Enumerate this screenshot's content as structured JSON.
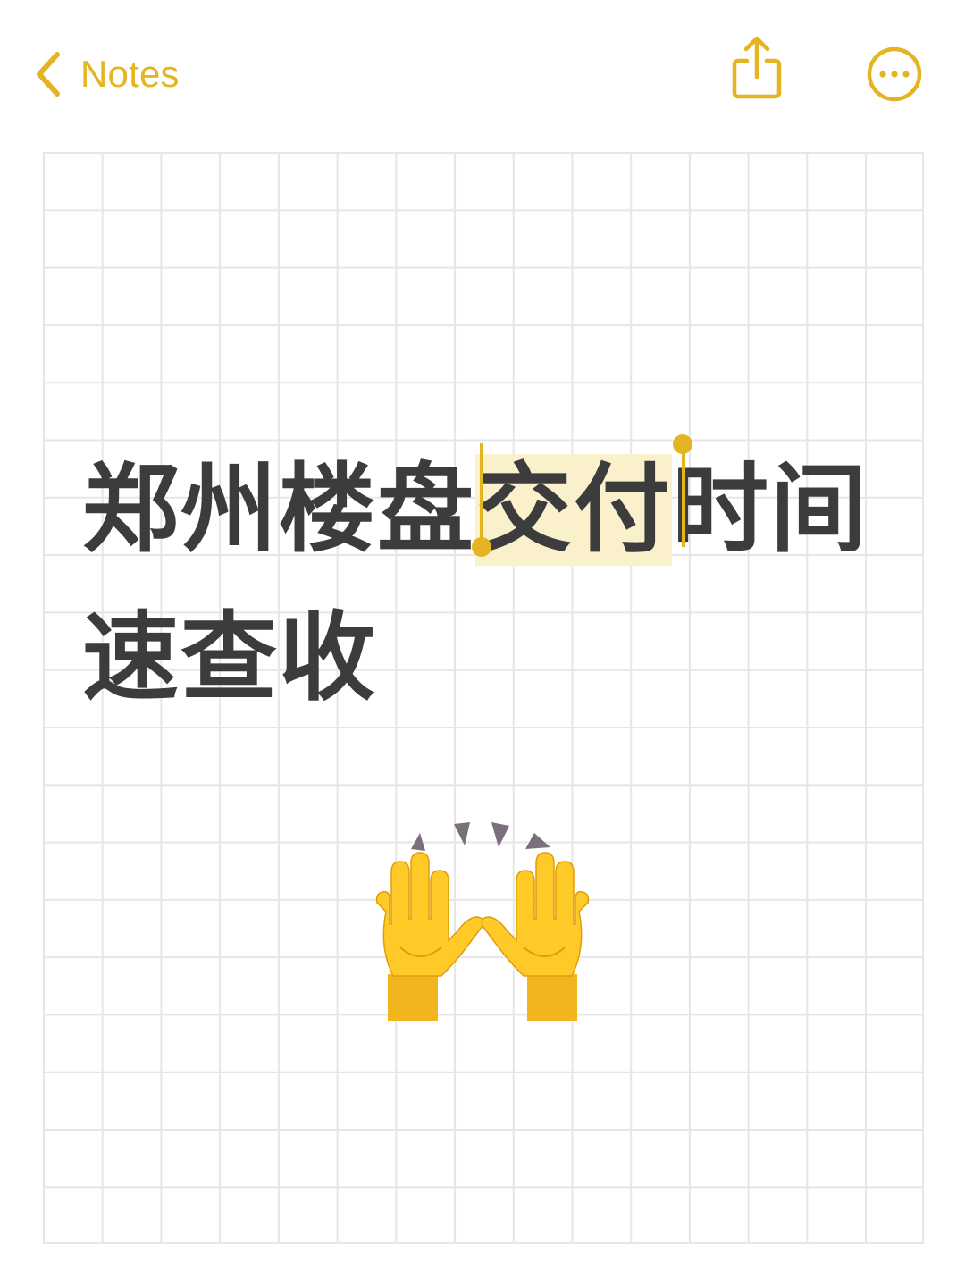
{
  "nav": {
    "back_label": "Notes",
    "back_icon": "chevron-left-icon",
    "share_icon": "share-icon",
    "more_icon": "ellipsis-circle-icon"
  },
  "note": {
    "line1_before": "郑州楼盘",
    "line1_selected": "交付",
    "line1_after": "时间",
    "line2": "速查收",
    "emoji": "raising-hands-emoji"
  },
  "colors": {
    "accent": "#E5B422",
    "selection": "#FBF0CC",
    "text": "#3C3C3C",
    "grid": "#E6E6E6"
  }
}
